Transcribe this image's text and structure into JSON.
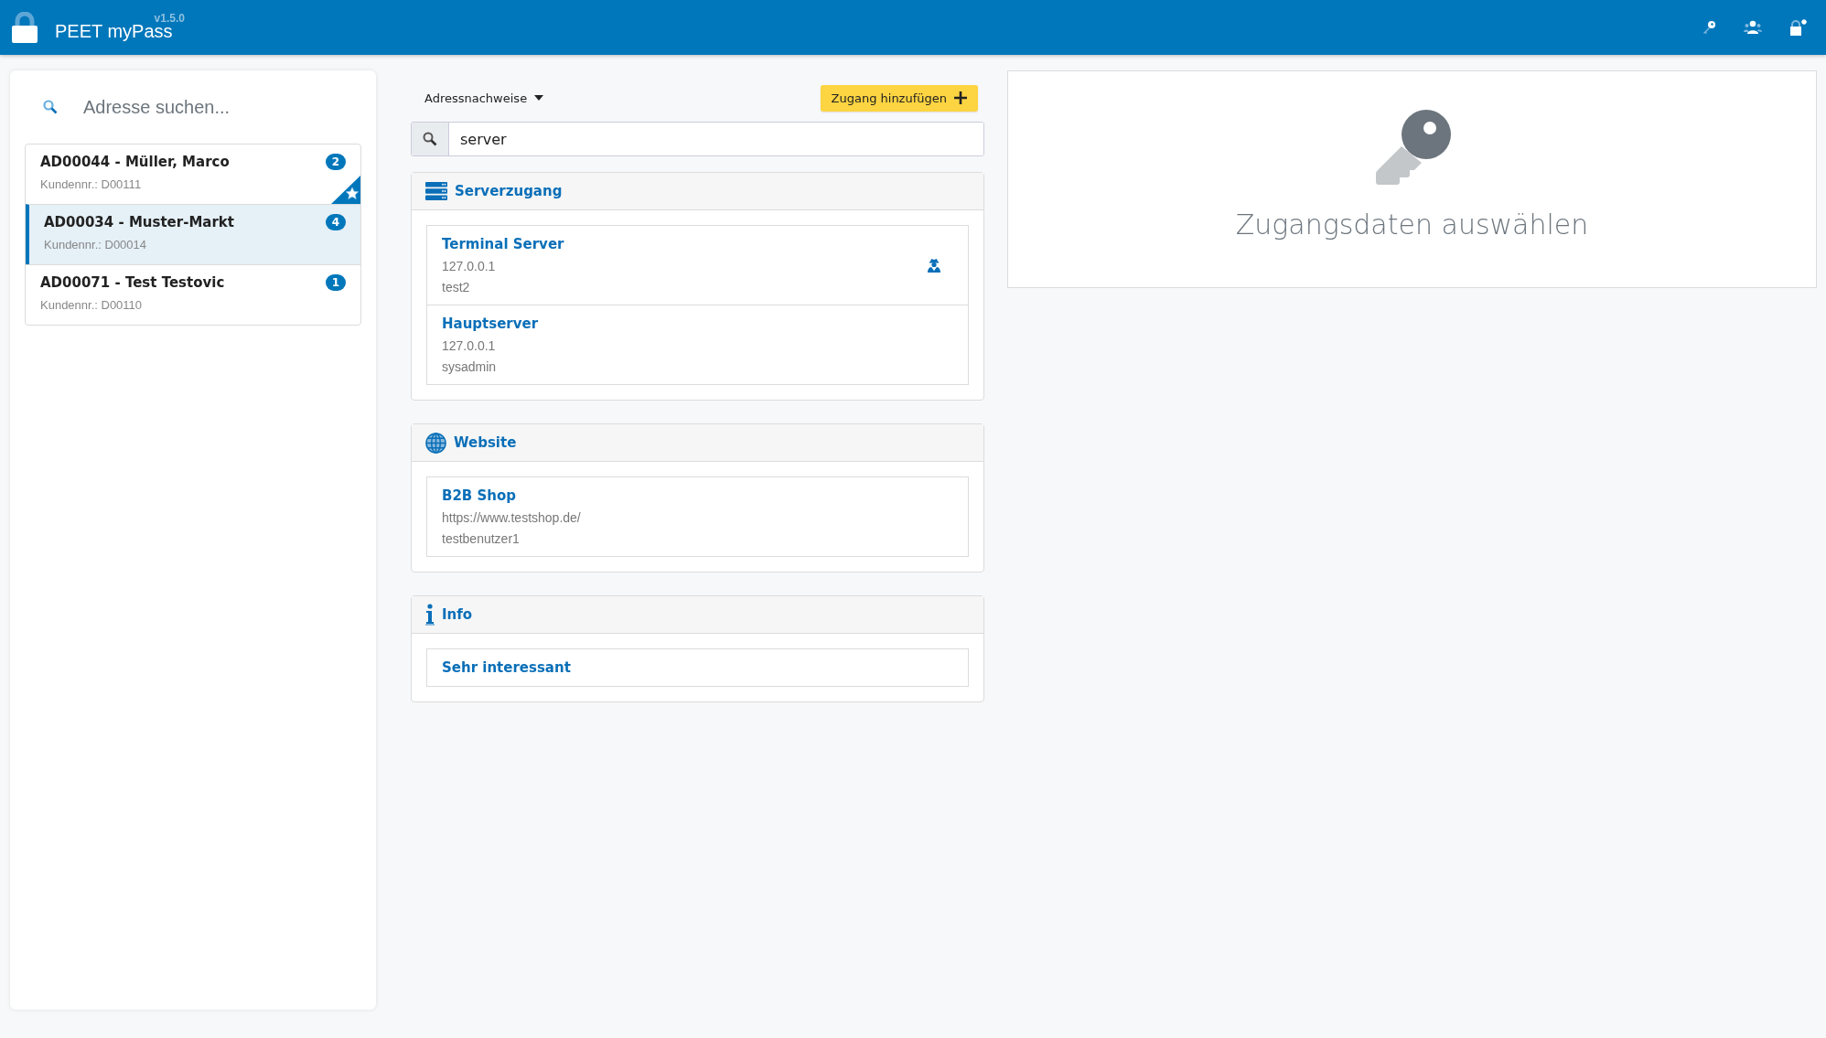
{
  "header": {
    "app_name": "PEET myPass",
    "version": "v1.5.0"
  },
  "address_panel": {
    "search": {
      "placeholder": "Adresse suchen..."
    },
    "addresses": [
      {
        "title": "AD00044 - Müller, Marco",
        "customer_no": "Kundennr.: D00111",
        "count": "2",
        "selected": false,
        "favorite": true
      },
      {
        "title": "AD00034 - Muster-Markt",
        "customer_no": "Kundennr.: D00014",
        "count": "4",
        "selected": true,
        "favorite": false
      },
      {
        "title": "AD00071 - Test Testovic",
        "customer_no": "Kundennr.: D00110",
        "count": "1",
        "selected": false,
        "favorite": false
      }
    ]
  },
  "credentials": {
    "filter_dropdown": "Adressnachweise",
    "add_button": "Zugang hinzufügen",
    "search": {
      "value": "server"
    },
    "sections": [
      {
        "kind": "server",
        "title": "Serverzugang",
        "entries": [
          {
            "title": "Terminal Server",
            "lines": [
              "127.0.0.1",
              "test2"
            ],
            "marked": true
          },
          {
            "title": "Hauptserver",
            "lines": [
              "127.0.0.1",
              "sysadmin"
            ],
            "marked": false
          }
        ]
      },
      {
        "kind": "website",
        "title": "Website",
        "entries": [
          {
            "title": "B2B Shop",
            "lines": [
              "https://www.testshop.de/",
              "testbenutzer1"
            ],
            "marked": false
          }
        ]
      },
      {
        "kind": "info",
        "title": "Info",
        "entries": [
          {
            "title": "Sehr interessant",
            "marked": false
          }
        ]
      }
    ]
  },
  "detail": {
    "empty_message": "Zugangsdaten auswählen"
  }
}
